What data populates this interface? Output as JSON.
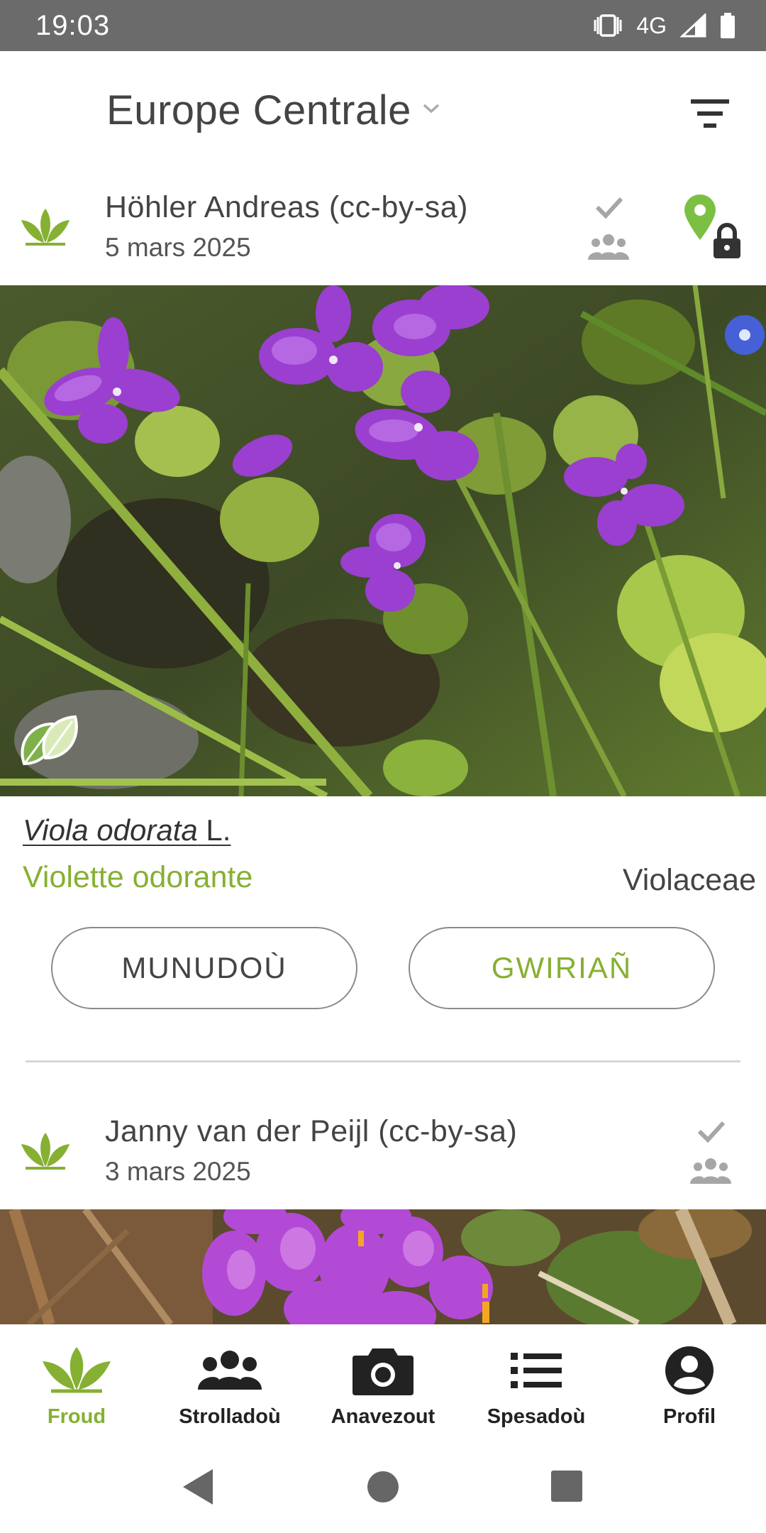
{
  "status_bar": {
    "time": "19:03",
    "network": "4G"
  },
  "header": {
    "region": "Europe Centrale"
  },
  "observations": [
    {
      "author": "Höhler Andreas (cc-by-sa)",
      "date": "5 mars 2025",
      "scientific_genus_species": "Viola odorata",
      "scientific_authority": "L.",
      "common_name": "Violette odorante",
      "family": "Violaceae",
      "buttons": {
        "details": "MUNUDOÙ",
        "verify": "GWIRIAÑ"
      }
    },
    {
      "author": "Janny van der Peijl (cc-by-sa)",
      "date": "3 mars 2025"
    }
  ],
  "bottom_nav": [
    {
      "label": "Froud",
      "icon": "sprout-icon",
      "active": true
    },
    {
      "label": "Strolladoù",
      "icon": "group-icon",
      "active": false
    },
    {
      "label": "Anavezout",
      "icon": "camera-icon",
      "active": false
    },
    {
      "label": "Spesadoù",
      "icon": "list-icon",
      "active": false
    },
    {
      "label": "Profil",
      "icon": "profile-icon",
      "active": false
    }
  ],
  "colors": {
    "accent": "#86b032",
    "statusbar": "#6b6b6b",
    "icon_gray": "#a6a6a6",
    "pin_green": "#7cc043"
  }
}
